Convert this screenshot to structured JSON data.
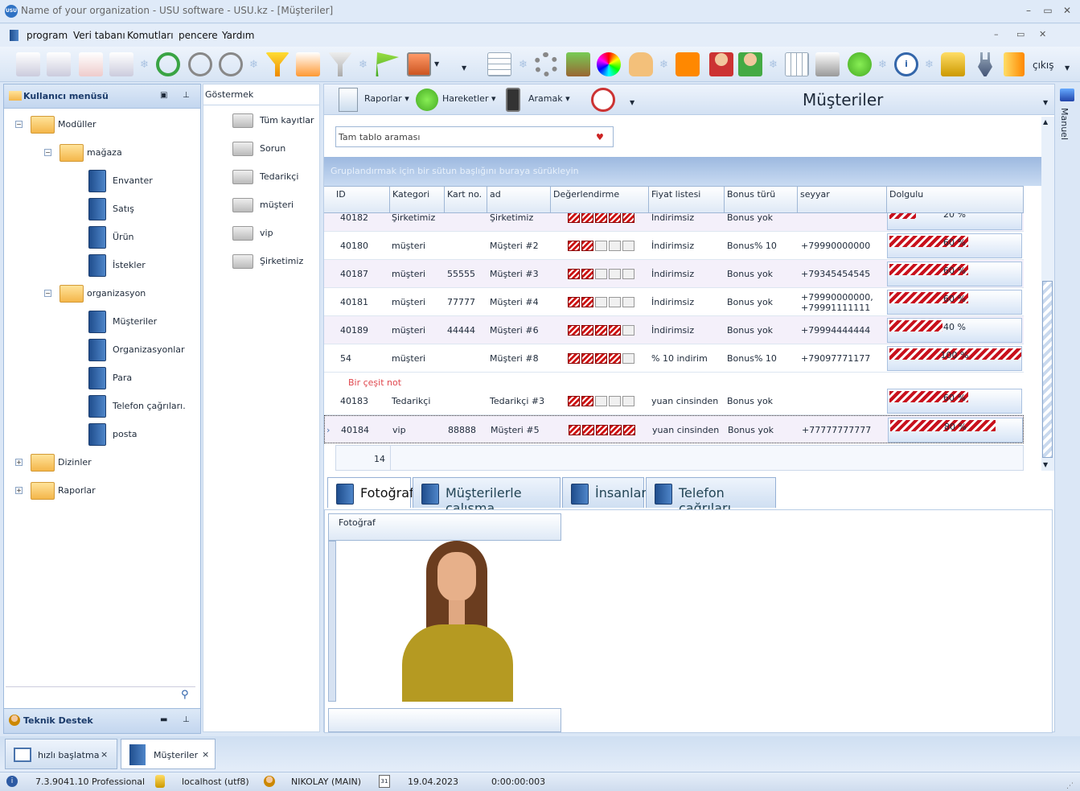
{
  "window": {
    "title": "Name of your organization - USU software - USU.kz - [Müşteriler]",
    "app_icon": "USU"
  },
  "menu": [
    "program",
    "Veri tabanı",
    "Komutları",
    "pencere",
    "Yardım"
  ],
  "toolbar": {
    "exit_label": "çıkış"
  },
  "left_panel": {
    "title": "Kullanıcı menüsü",
    "tree": [
      {
        "label": "Modüller",
        "level": 0,
        "type": "folder",
        "expander": "−"
      },
      {
        "label": "mağaza",
        "level": 1,
        "type": "folder",
        "expander": "−"
      },
      {
        "label": "Envanter",
        "level": 2,
        "type": "book"
      },
      {
        "label": "Satış",
        "level": 2,
        "type": "book"
      },
      {
        "label": "Ürün",
        "level": 2,
        "type": "book"
      },
      {
        "label": "İstekler",
        "level": 2,
        "type": "book"
      },
      {
        "label": "organizasyon",
        "level": 1,
        "type": "folder",
        "expander": "−"
      },
      {
        "label": "Müşteriler",
        "level": 2,
        "type": "book"
      },
      {
        "label": "Organizasyonlar",
        "level": 2,
        "type": "book"
      },
      {
        "label": "Para",
        "level": 2,
        "type": "book"
      },
      {
        "label": "Telefon çağrıları.",
        "level": 2,
        "type": "book"
      },
      {
        "label": "posta",
        "level": 2,
        "type": "book"
      },
      {
        "label": "Dizinler",
        "level": 0,
        "type": "folder",
        "expander": "+"
      },
      {
        "label": "Raporlar",
        "level": 0,
        "type": "folder",
        "expander": "+"
      }
    ],
    "tech_support": "Teknik Destek"
  },
  "show_panel": {
    "title": "Göstermek",
    "items": [
      "Tüm kayıtlar",
      "Sorun",
      "Tedarikçi",
      "müşteri",
      "vip",
      "Şirketimiz"
    ]
  },
  "main": {
    "toolbar": {
      "reports": "Raporlar",
      "movements": "Hareketler",
      "search": "Aramak"
    },
    "page_title": "Müşteriler",
    "search_placeholder": "Tam tablo araması",
    "group_hint": "Gruplandırmak için bir sütun başlığını buraya sürükleyin",
    "columns": [
      "ID",
      "Kategori",
      "Kart no.",
      "ad",
      "Değerlendirme",
      "Fiyat listesi",
      "Bonus türü",
      "seyyar",
      "Dolgulu"
    ],
    "rows": [
      {
        "id": "40182",
        "kategori": "Şirketimiz",
        "kart": "",
        "ad": "Şirketimiz",
        "rating": 5,
        "fiyat": "İndirimsiz",
        "bonus": "Bonus yok",
        "seyyar": "",
        "dolgu": 20,
        "dolgu_text": "20 %"
      },
      {
        "id": "40180",
        "kategori": "müşteri",
        "kart": "",
        "ad": "Müşteri #2",
        "rating": 2,
        "fiyat": "İndirimsiz",
        "bonus": "Bonus% 10",
        "seyyar": "+79990000000",
        "dolgu": 60,
        "dolgu_text": "60 %"
      },
      {
        "id": "40187",
        "kategori": "müşteri",
        "kart": "55555",
        "ad": "Müşteri #3",
        "rating": 2,
        "fiyat": "İndirimsiz",
        "bonus": "Bonus yok",
        "seyyar": "+79345454545",
        "dolgu": 60,
        "dolgu_text": "60 %"
      },
      {
        "id": "40181",
        "kategori": "müşteri",
        "kart": "77777",
        "ad": "Müşteri #4",
        "rating": 2,
        "fiyat": "İndirimsiz",
        "bonus": "Bonus yok",
        "seyyar": "+79990000000,",
        "seyyar2": "+79991111111",
        "dolgu": 60,
        "dolgu_text": "60 %"
      },
      {
        "id": "40189",
        "kategori": "müşteri",
        "kart": "44444",
        "ad": "Müşteri #6",
        "rating": 4,
        "fiyat": "İndirimsiz",
        "bonus": "Bonus yok",
        "seyyar": "+79994444444",
        "dolgu": 40,
        "dolgu_text": "40 %"
      },
      {
        "id": "54",
        "kategori": "müşteri",
        "kart": "",
        "ad": "Müşteri #8",
        "rating": 4,
        "fiyat": "% 10 indirim",
        "bonus": "Bonus% 10",
        "seyyar": "+79097771177",
        "dolgu": 100,
        "dolgu_text": "100 %"
      }
    ],
    "note": "Bir çeşit not",
    "rows2": [
      {
        "id": "40183",
        "kategori": "Tedarikçi",
        "kart": "",
        "ad": "Tedarikçi #3",
        "rating": 2,
        "fiyat": "yuan cinsinden",
        "bonus": "Bonus yok",
        "seyyar": "",
        "dolgu": 60,
        "dolgu_text": "60 %"
      },
      {
        "id": "40184",
        "kategori": "vip",
        "kart": "88888",
        "ad": "Müşteri #5",
        "rating": 5,
        "fiyat": "yuan cinsinden",
        "bonus": "Bonus yok",
        "seyyar": "+77777777777",
        "dolgu": 80,
        "dolgu_text": "80 %"
      }
    ],
    "count": "14",
    "tabs": [
      "Fotoğraf",
      "Müşterilerle çalışma",
      "İnsanlar",
      "Telefon çağrıları"
    ],
    "photo_label": "Fotoğraf"
  },
  "right_strip": {
    "label": "Manuel"
  },
  "taskbar": [
    {
      "label": "hızlı başlatma",
      "close": "×"
    },
    {
      "label": "Müşteriler",
      "close": "×"
    }
  ],
  "status": {
    "version": "7.3.9041.10 Professional",
    "db": "localhost (utf8)",
    "user": "NIKOLAY (MAIN)",
    "date_icon": "31",
    "date": "19.04.2023",
    "timer": "0:00:00:003"
  }
}
